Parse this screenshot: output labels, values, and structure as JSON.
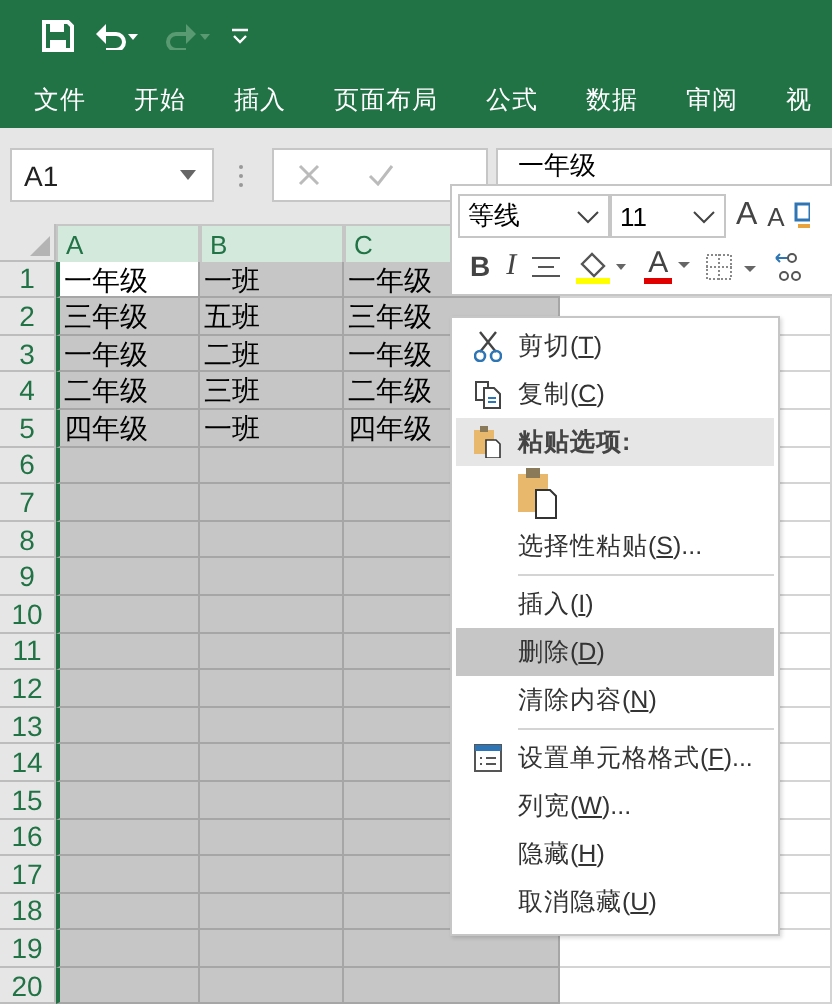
{
  "ribbon_tabs": [
    "文件",
    "开始",
    "插入",
    "页面布局",
    "公式",
    "数据",
    "审阅",
    "视"
  ],
  "name_box": "A1",
  "formula": "一年级",
  "columns": [
    {
      "label": "A",
      "selected": true
    },
    {
      "label": "B",
      "selected": true
    },
    {
      "label": "C",
      "selected": true
    }
  ],
  "rows": [
    {
      "num": "1",
      "cells": [
        "一年级",
        "一班",
        "一年级"
      ]
    },
    {
      "num": "2",
      "cells": [
        "三年级",
        "五班",
        "三年级"
      ]
    },
    {
      "num": "3",
      "cells": [
        "一年级",
        "二班",
        "一年级"
      ]
    },
    {
      "num": "4",
      "cells": [
        "二年级",
        "三班",
        "二年级"
      ]
    },
    {
      "num": "5",
      "cells": [
        "四年级",
        "一班",
        "四年级"
      ]
    },
    {
      "num": "6",
      "cells": [
        "",
        "",
        ""
      ]
    },
    {
      "num": "7",
      "cells": [
        "",
        "",
        ""
      ]
    },
    {
      "num": "8",
      "cells": [
        "",
        "",
        ""
      ]
    },
    {
      "num": "9",
      "cells": [
        "",
        "",
        ""
      ]
    },
    {
      "num": "10",
      "cells": [
        "",
        "",
        ""
      ]
    },
    {
      "num": "11",
      "cells": [
        "",
        "",
        ""
      ]
    },
    {
      "num": "12",
      "cells": [
        "",
        "",
        ""
      ]
    },
    {
      "num": "13",
      "cells": [
        "",
        "",
        ""
      ]
    },
    {
      "num": "14",
      "cells": [
        "",
        "",
        ""
      ]
    },
    {
      "num": "15",
      "cells": [
        "",
        "",
        ""
      ]
    },
    {
      "num": "16",
      "cells": [
        "",
        "",
        ""
      ]
    },
    {
      "num": "17",
      "cells": [
        "",
        "",
        ""
      ]
    },
    {
      "num": "18",
      "cells": [
        "",
        "",
        ""
      ]
    },
    {
      "num": "19",
      "cells": [
        "",
        "",
        ""
      ]
    },
    {
      "num": "20",
      "cells": [
        "",
        "",
        ""
      ]
    }
  ],
  "mini_toolbar": {
    "font": "等线",
    "size": "11",
    "grow_glyph": "A",
    "shrink_glyph": "A",
    "bold_glyph": "B",
    "italic_glyph": "I",
    "font_color_glyph": "A"
  },
  "context_menu": [
    {
      "kind": "cut",
      "label": "剪切(",
      "key": "T",
      "tail": ")",
      "selected": false
    },
    {
      "kind": "copy",
      "label": "复制(",
      "key": "C",
      "tail": ")",
      "selected": false
    },
    {
      "kind": "header",
      "label": "粘贴选项:"
    },
    {
      "kind": "paste-options"
    },
    {
      "kind": "item",
      "label": "选择性粘贴(",
      "key": "S",
      "tail": ")...",
      "selected": false
    },
    {
      "kind": "separator"
    },
    {
      "kind": "item",
      "label": "插入(",
      "key": "I",
      "tail": ")",
      "selected": false
    },
    {
      "kind": "item",
      "label": "删除(",
      "key": "D",
      "tail": ")",
      "selected": true
    },
    {
      "kind": "item",
      "label": "清除内容(",
      "key": "N",
      "tail": ")",
      "selected": false
    },
    {
      "kind": "separator"
    },
    {
      "kind": "format",
      "label": "设置单元格格式(",
      "key": "F",
      "tail": ")...",
      "selected": false
    },
    {
      "kind": "item",
      "label": "列宽(",
      "key": "W",
      "tail": ")...",
      "selected": false
    },
    {
      "kind": "item",
      "label": "隐藏(",
      "key": "H",
      "tail": ")",
      "selected": false
    },
    {
      "kind": "item",
      "label": "取消隐藏(",
      "key": "U",
      "tail": ")",
      "selected": false
    }
  ]
}
